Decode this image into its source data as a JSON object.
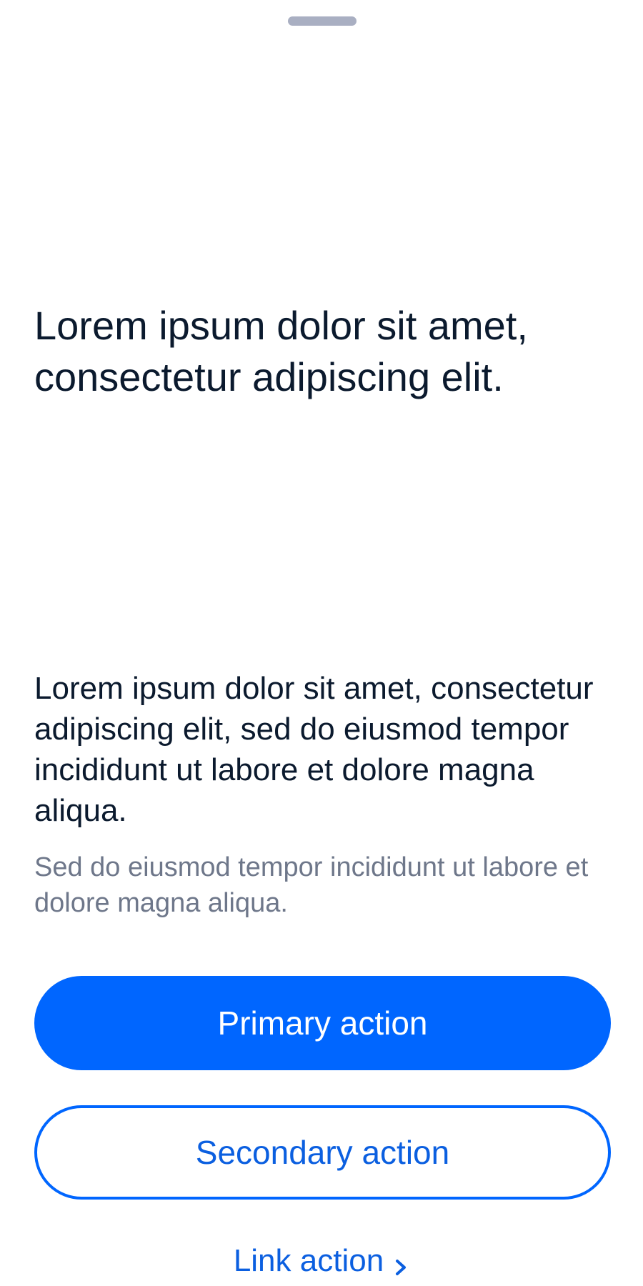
{
  "content": {
    "headline": "Lorem ipsum dolor sit amet, consectetur adipiscing elit.",
    "body": "Lorem ipsum dolor sit amet, consectetur adipiscing elit, sed do eiusmod tempor incididunt ut labore et dolore magna aliqua.",
    "secondary_text": "Sed do eiusmod tempor incididunt ut labore et dolore magna aliqua."
  },
  "actions": {
    "primary_label": "Primary action",
    "secondary_label": "Secondary action",
    "link_label": "Link action",
    "link_icon": "chevron-right-icon"
  },
  "colors": {
    "accent": "#0066ff",
    "text_primary": "#0b1a2e",
    "text_secondary": "#6e778a",
    "grabber": "#a9afc2"
  }
}
